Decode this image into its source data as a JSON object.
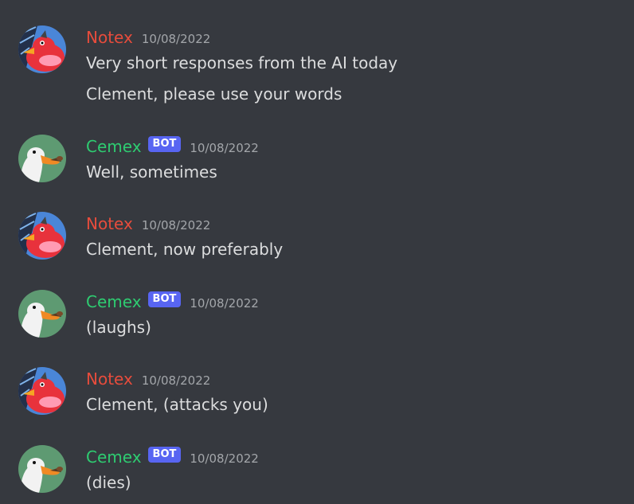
{
  "colors": {
    "background": "#36393f",
    "notex_name": "#e74c3c",
    "cemex_name": "#2ecc71",
    "bot_badge": "#5865f2",
    "timestamp": "#a3a6aa",
    "message_text": "#dcddde"
  },
  "messages": [
    {
      "author": "Notex",
      "avatar_icon": "red-bird-avatar-icon",
      "timestamp": "10/08/2022",
      "lines": [
        "Very short responses from the AI today",
        "Clement, please use your words"
      ]
    },
    {
      "author": "Cemex",
      "badge": "BOT",
      "avatar_icon": "goose-avatar-icon",
      "timestamp": "10/08/2022",
      "lines": [
        "Well, sometimes"
      ]
    },
    {
      "author": "Notex",
      "avatar_icon": "red-bird-avatar-icon",
      "timestamp": "10/08/2022",
      "lines": [
        "Clement, now preferably"
      ]
    },
    {
      "author": "Cemex",
      "badge": "BOT",
      "avatar_icon": "goose-avatar-icon",
      "timestamp": "10/08/2022",
      "lines": [
        "(laughs)"
      ]
    },
    {
      "author": "Notex",
      "avatar_icon": "red-bird-avatar-icon",
      "timestamp": "10/08/2022",
      "lines": [
        "Clement, (attacks you)"
      ]
    },
    {
      "author": "Cemex",
      "badge": "BOT",
      "avatar_icon": "goose-avatar-icon",
      "timestamp": "10/08/2022",
      "lines": [
        "(dies)"
      ]
    }
  ]
}
